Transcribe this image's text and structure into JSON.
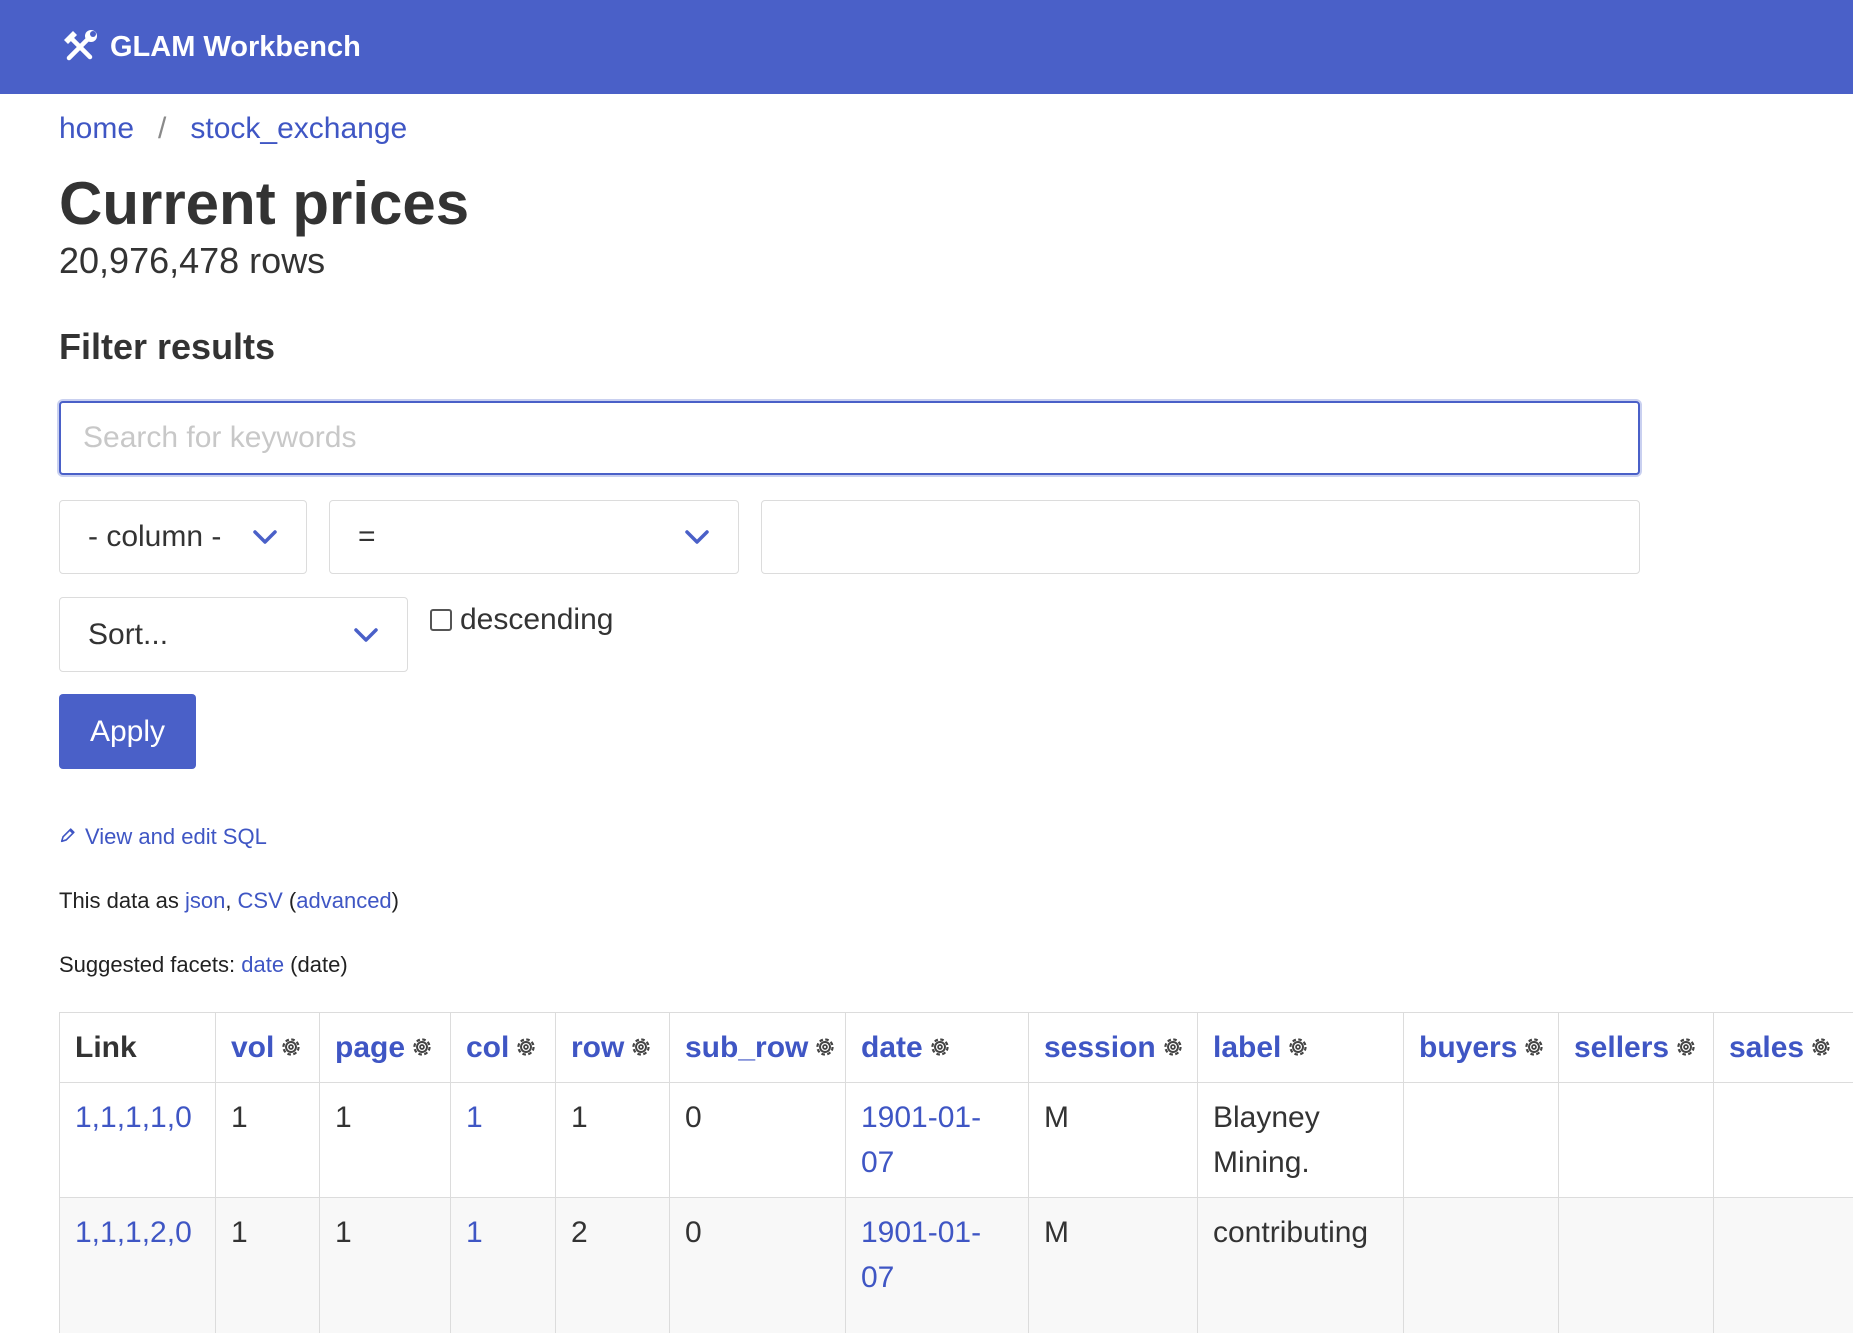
{
  "header": {
    "brand": "GLAM Workbench",
    "brand_icon": "tools-icon",
    "color": "#4a60c8"
  },
  "breadcrumb": {
    "home": "home",
    "separator": "/",
    "db": "stock_exchange"
  },
  "title": "Current prices",
  "row_count": "20,976,478 rows",
  "filter": {
    "heading": "Filter results",
    "search_placeholder": "Search for keywords",
    "column_select": "- column -",
    "operator_select": "=",
    "value": "",
    "sort_select": "Sort...",
    "descending_label": "descending",
    "descending_checked": false,
    "apply_label": "Apply"
  },
  "links": {
    "sql_icon": "pencil-icon",
    "sql": "View and edit SQL",
    "data_as_prefix": "This data as ",
    "json": "json",
    "comma": ", ",
    "csv": "CSV",
    "paren_open": " (",
    "advanced": "advanced",
    "paren_close": ")",
    "facets_prefix": "Suggested facets: ",
    "facet_date": "date",
    "facet_date_suffix": " (date)"
  },
  "table": {
    "columns": [
      "Link",
      "vol",
      "page",
      "col",
      "row",
      "sub_row",
      "date",
      "session",
      "label",
      "buyers",
      "sellers",
      "sales"
    ],
    "rows": [
      {
        "link": "1,1,1,1,0",
        "vol": "1",
        "page": "1",
        "col": "1",
        "row": "1",
        "sub_row": "0",
        "date": "1901-01-07",
        "session": "M",
        "label": "Blayney Mining.",
        "buyers": "",
        "sellers": "",
        "sales": ""
      },
      {
        "link": "1,1,1,2,0",
        "vol": "1",
        "page": "1",
        "col": "1",
        "row": "2",
        "sub_row": "0",
        "date": "1901-01-07",
        "session": "M",
        "label": "contributing",
        "buyers": "",
        "sellers": "",
        "sales": ""
      }
    ]
  }
}
